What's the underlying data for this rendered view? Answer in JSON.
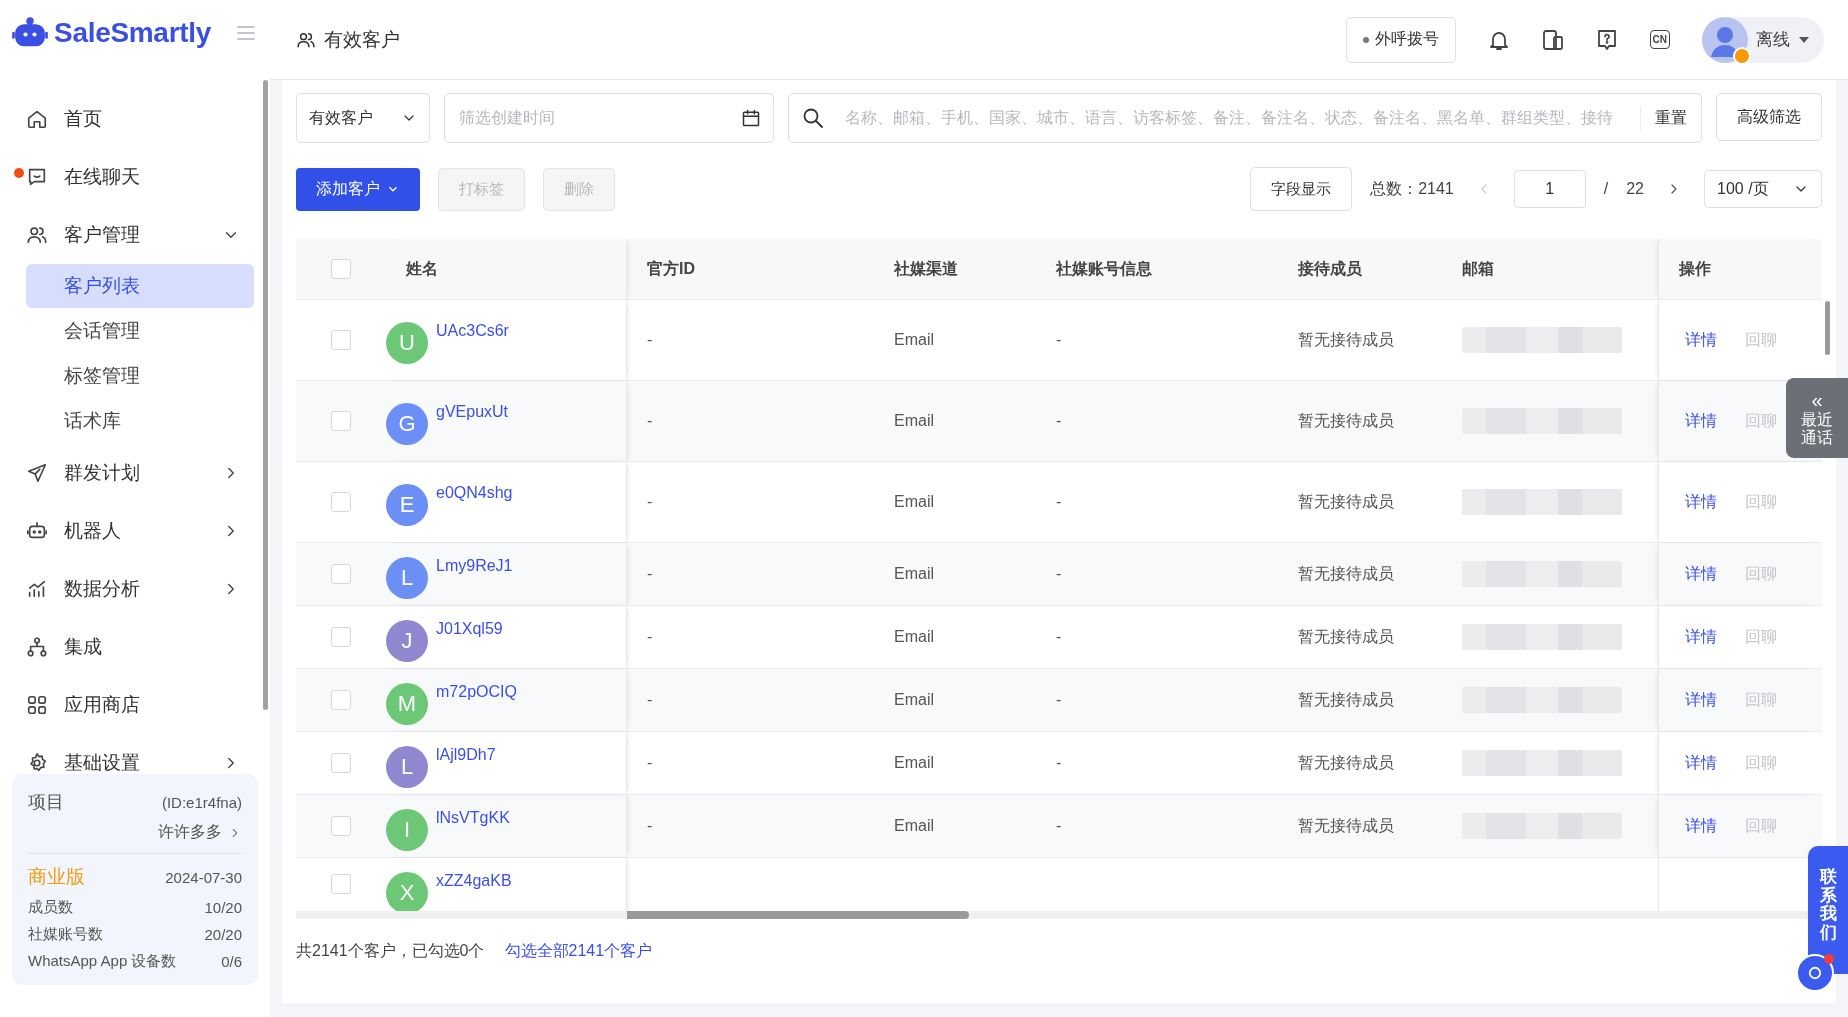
{
  "sidebar": {
    "logo": "SaleSmartly",
    "nav": [
      {
        "label": "首页",
        "unread": false
      },
      {
        "label": "在线聊天",
        "unread": true
      },
      {
        "label": "客户管理",
        "unread": false,
        "expanded": true,
        "children": [
          {
            "label": "客户列表",
            "selected": true
          },
          {
            "label": "会话管理",
            "selected": false
          },
          {
            "label": "标签管理",
            "selected": false
          },
          {
            "label": "话术库",
            "selected": false
          }
        ]
      },
      {
        "label": "群发计划",
        "unread": false,
        "expanded": false
      },
      {
        "label": "机器人",
        "unread": false,
        "expanded": false
      },
      {
        "label": "数据分析",
        "unread": false,
        "expanded": false
      },
      {
        "label": "集成",
        "unread": false
      },
      {
        "label": "应用商店",
        "unread": false
      },
      {
        "label": "基础设置",
        "unread": false,
        "expanded": false
      }
    ],
    "project": {
      "label": "项目",
      "id": "(ID:e1r4fna)",
      "owner": "许许多多",
      "plan": "商业版",
      "expiry": "2024-07-30",
      "stats": [
        {
          "label": "成员数",
          "value": "10/20"
        },
        {
          "label": "社媒账号数",
          "value": "20/20"
        },
        {
          "label": "WhatsApp App 设备数",
          "value": "0/6"
        }
      ]
    }
  },
  "topbar": {
    "page_title": "有效客户",
    "call_button": "外呼拨号",
    "lang": "CN",
    "user_status": "离线"
  },
  "filters": {
    "segment": "有效客户",
    "date_placeholder": "筛选创建时间",
    "search_placeholder": "名称、邮箱、手机、国家、城市、语言、访客标签、备注、备注名、状态、备注名、黑名单、群组类型、接待",
    "reset": "重置",
    "advanced": "高级筛选"
  },
  "toolbar": {
    "add": "添加客户",
    "buttons": [
      {
        "label": "打标签",
        "disabled": true
      },
      {
        "label": "删除",
        "disabled": true
      }
    ]
  },
  "pagination": {
    "fields": "字段显示",
    "total": "总数：2141",
    "prev_disabled": true,
    "page": "1",
    "separator": "/",
    "pages": "22",
    "page_size": "100 /页"
  },
  "table": {
    "header_checked": false,
    "columns": [
      "姓名",
      "官方ID",
      "社媒渠道",
      "社媒账号信息",
      "接待成员",
      "邮箱",
      "操作"
    ],
    "rows": [
      {
        "letter": "U",
        "color": "#6cc777",
        "name": "UAc3Cs6r",
        "checked": false,
        "official_id": "-",
        "channel": "Email",
        "account_info": "-",
        "agent": "暂无接待成员",
        "actions": [
          {
            "label": "详情",
            "disabled": false
          },
          {
            "label": "回聊",
            "disabled": true
          }
        ]
      },
      {
        "letter": "G",
        "color": "#6b8ff5",
        "name": "gVEpuxUt",
        "checked": false,
        "official_id": "-",
        "channel": "Email",
        "account_info": "-",
        "agent": "暂无接待成员",
        "actions": [
          {
            "label": "详情",
            "disabled": false
          },
          {
            "label": "回聊",
            "disabled": true
          }
        ]
      },
      {
        "letter": "E",
        "color": "#6b8ff5",
        "name": "e0QN4shg",
        "checked": false,
        "official_id": "-",
        "channel": "Email",
        "account_info": "-",
        "agent": "暂无接待成员",
        "actions": [
          {
            "label": "详情",
            "disabled": false
          },
          {
            "label": "回聊",
            "disabled": true
          }
        ]
      },
      {
        "letter": "L",
        "color": "#6b8ff5",
        "name": "Lmy9ReJ1",
        "checked": false,
        "official_id": "-",
        "channel": "Email",
        "account_info": "-",
        "agent": "暂无接待成员",
        "actions": [
          {
            "label": "详情",
            "disabled": false
          },
          {
            "label": "回聊",
            "disabled": true
          }
        ]
      },
      {
        "letter": "J",
        "color": "#8f87cf",
        "name": "J01Xql59",
        "checked": false,
        "official_id": "-",
        "channel": "Email",
        "account_info": "-",
        "agent": "暂无接待成员",
        "actions": [
          {
            "label": "详情",
            "disabled": false
          },
          {
            "label": "回聊",
            "disabled": true
          }
        ]
      },
      {
        "letter": "M",
        "color": "#6cc777",
        "name": "m72pOCIQ",
        "checked": false,
        "official_id": "-",
        "channel": "Email",
        "account_info": "-",
        "agent": "暂无接待成员",
        "actions": [
          {
            "label": "详情",
            "disabled": false
          },
          {
            "label": "回聊",
            "disabled": true
          }
        ]
      },
      {
        "letter": "L",
        "color": "#8f87cf",
        "name": "lAjl9Dh7",
        "checked": false,
        "official_id": "-",
        "channel": "Email",
        "account_info": "-",
        "agent": "暂无接待成员",
        "actions": [
          {
            "label": "详情",
            "disabled": false
          },
          {
            "label": "回聊",
            "disabled": true
          }
        ]
      },
      {
        "letter": "I",
        "color": "#6cc777",
        "name": "lNsVTgKK",
        "checked": false,
        "official_id": "-",
        "channel": "Email",
        "account_info": "-",
        "agent": "暂无接待成员",
        "actions": [
          {
            "label": "详情",
            "disabled": false
          },
          {
            "label": "回聊",
            "disabled": true
          }
        ]
      },
      {
        "letter": "X",
        "color": "#6cc777",
        "name": "xZZ4gaKB",
        "checked": false
      }
    ]
  },
  "footer": {
    "summary": "共2141个客户，已勾选0个",
    "select_all": "勾选全部2141个客户"
  },
  "floating": {
    "recent_arrow": "«",
    "recent_label": "最近通话",
    "contact_label": "联系我们"
  }
}
